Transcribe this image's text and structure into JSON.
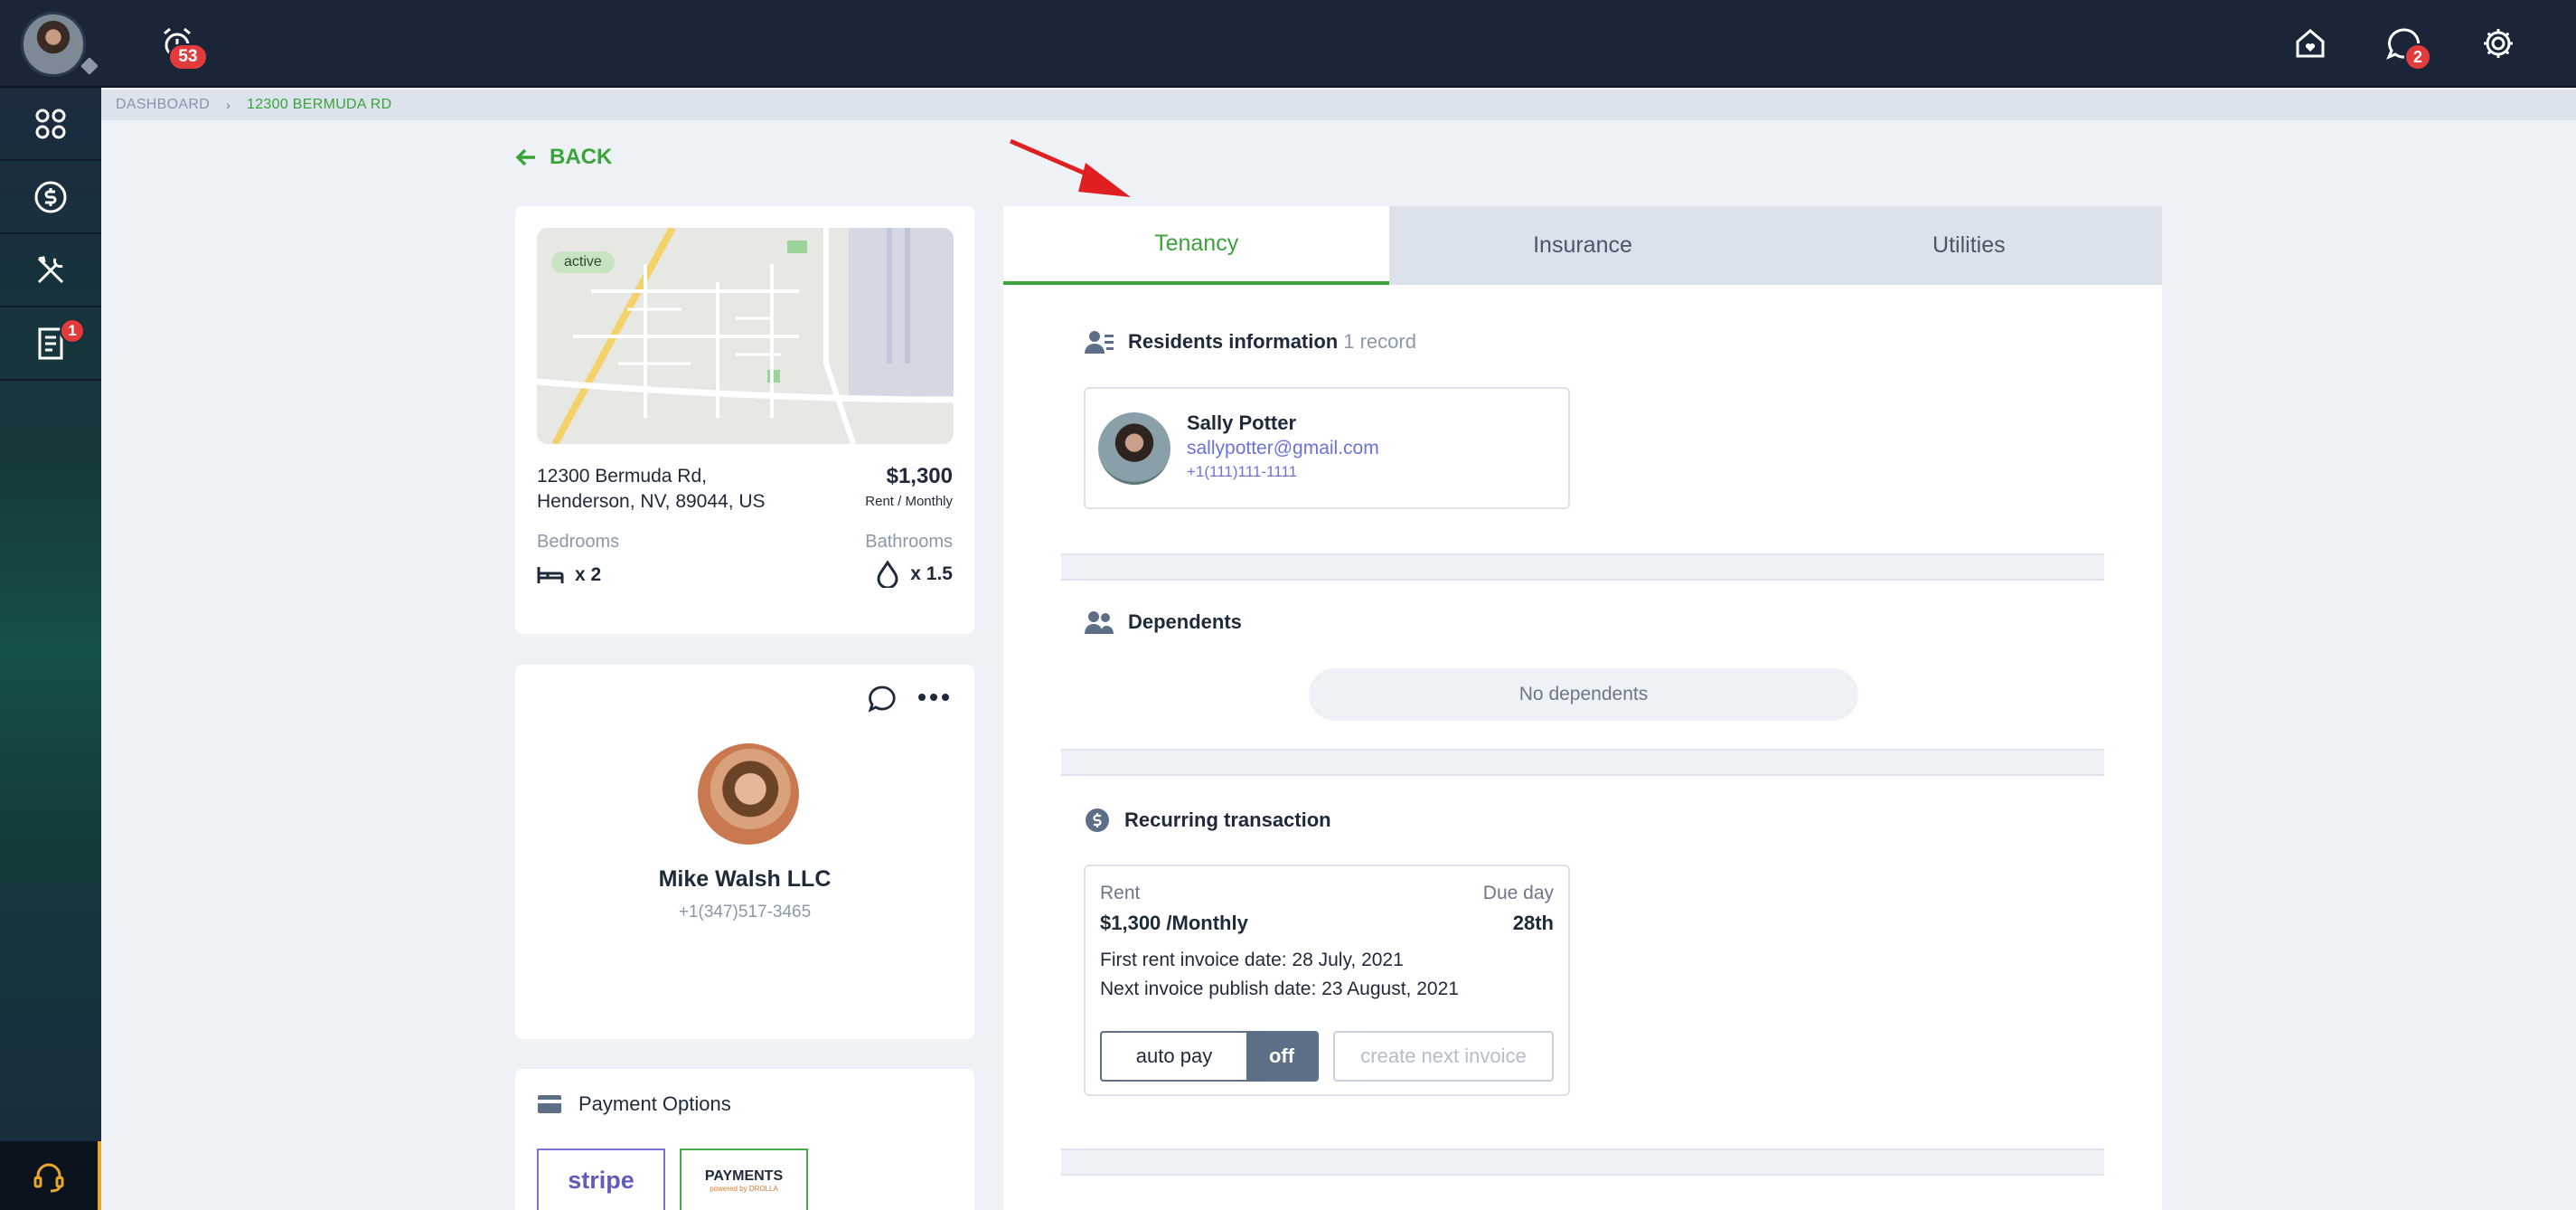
{
  "topbar": {
    "alarm_count": "53",
    "messages_count": "2"
  },
  "sidebar": {
    "documents_badge": "1"
  },
  "breadcrumb": {
    "root": "DASHBOARD",
    "current": "12300 BERMUDA RD"
  },
  "back_label": "BACK",
  "property": {
    "status": "active",
    "address_line1": "12300 Bermuda Rd,",
    "address_line2": "Henderson, NV, 89044, US",
    "price": "$1,300",
    "price_period": "Rent / Monthly",
    "bedrooms_label": "Bedrooms",
    "bedrooms_value": "x 2",
    "bathrooms_label": "Bathrooms",
    "bathrooms_value": "x 1.5"
  },
  "owner": {
    "name": "Mike Walsh LLC",
    "phone": "+1(347)517-3465"
  },
  "payment": {
    "title": "Payment Options",
    "stripe": "stripe",
    "payments_logo": "PAYMENTS",
    "payments_sub": "powered by DROLLA"
  },
  "tabs": [
    "Tenancy",
    "Insurance",
    "Utilities"
  ],
  "residents": {
    "title": "Residents information",
    "count": "1 record",
    "name": "Sally Potter",
    "email": "sallypotter@gmail.com",
    "phone": "+1(111)111-1111"
  },
  "dependents": {
    "title": "Dependents",
    "empty": "No dependents"
  },
  "recurring": {
    "title": "Recurring transaction",
    "rent_label": "Rent",
    "amount": "$1,300 /Monthly",
    "due_label": "Due day",
    "due_value": "28th",
    "first_invoice": "First rent invoice date: 28 July, 2021",
    "next_invoice": "Next invoice publish date: 23 August, 2021",
    "autopay_label": "auto pay",
    "autopay_state": "off",
    "create_invoice": "create next invoice"
  },
  "colors": {
    "accent": "#3aa33a",
    "badge": "#e23b3b",
    "topbar": "#1a2538",
    "link": "#6a73d8"
  }
}
